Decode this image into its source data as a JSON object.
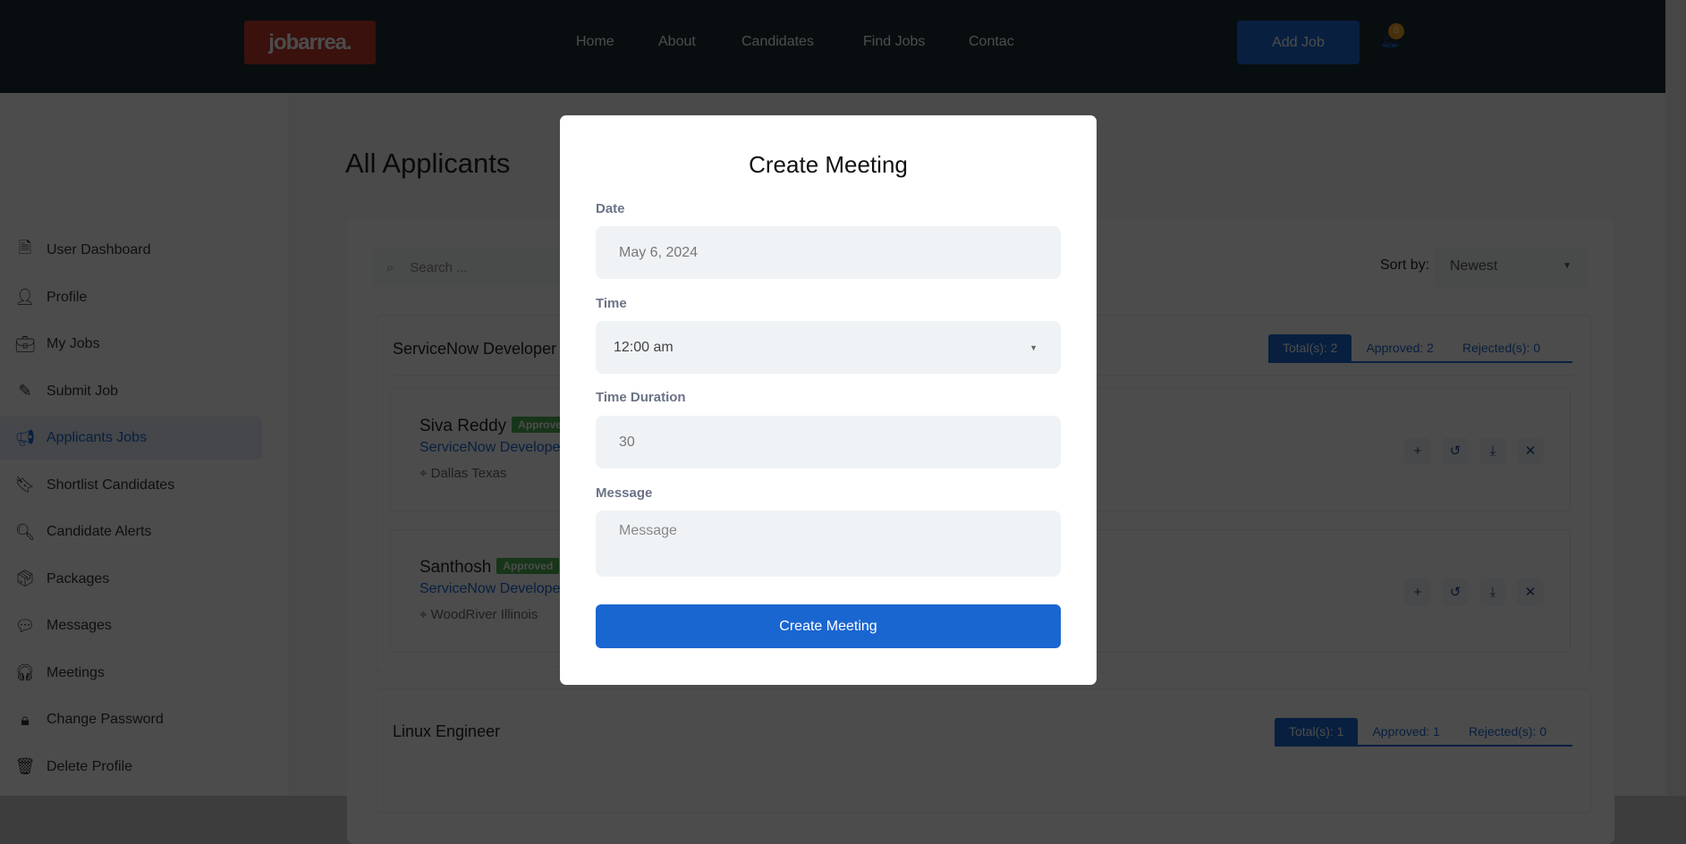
{
  "header": {
    "logo": "jobarrea.",
    "nav": [
      "Home",
      "About",
      "Candidates",
      "Find Jobs",
      "Contac"
    ],
    "add_job": "Add Job",
    "notification_count": "0"
  },
  "sidebar": {
    "items": [
      {
        "label": "User Dashboard",
        "icon": "dashboard-icon"
      },
      {
        "label": "Profile",
        "icon": "user-icon"
      },
      {
        "label": "My Jobs",
        "icon": "briefcase-icon"
      },
      {
        "label": "Submit Job",
        "icon": "pencil-icon"
      },
      {
        "label": "Applicants Jobs",
        "icon": "megaphone-icon",
        "active": true
      },
      {
        "label": "Shortlist Candidates",
        "icon": "bookmark-icon"
      },
      {
        "label": "Candidate Alerts",
        "icon": "search-user-icon"
      },
      {
        "label": "Packages",
        "icon": "box-icon"
      },
      {
        "label": "Messages",
        "icon": "chat-icon"
      },
      {
        "label": "Meetings",
        "icon": "headset-icon"
      },
      {
        "label": "Change Password",
        "icon": "lock-icon"
      },
      {
        "label": "Delete Profile",
        "icon": "trash-icon"
      }
    ]
  },
  "main": {
    "title": "All Applicants",
    "search_placeholder": "Search ...",
    "sort_label": "Sort by:",
    "sort_value": "Newest",
    "jobs": [
      {
        "title": "ServiceNow Developer",
        "total": "Total(s): 2",
        "approved": "Approved: 2",
        "rejected": "Rejected(s): 0",
        "applicants": [
          {
            "name": "Siva Reddy",
            "status": "Approved",
            "role": "ServiceNow Developer",
            "location": "Dallas Texas"
          },
          {
            "name": "Santhosh",
            "status": "Approved",
            "role": "ServiceNow Developer",
            "location": "WoodRiver Illinois"
          }
        ]
      },
      {
        "title": "Linux Engineer",
        "total": "Total(s): 1",
        "approved": "Approved: 1",
        "rejected": "Rejected(s): 0"
      }
    ]
  },
  "modal": {
    "title": "Create Meeting",
    "date_label": "Date",
    "date_value": "May 6, 2024",
    "time_label": "Time",
    "time_value": "12:00 am",
    "duration_label": "Time Duration",
    "duration_value": "30",
    "message_label": "Message",
    "message_placeholder": "Message",
    "submit": "Create Meeting"
  },
  "colors": {
    "accent": "#1a66d1",
    "logo": "#c0392b",
    "approved": "#4caf50"
  }
}
